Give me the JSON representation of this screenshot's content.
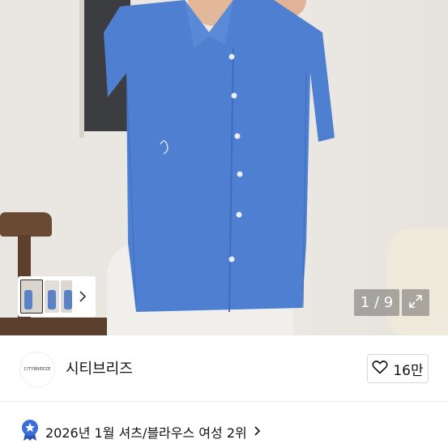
{
  "gallery": {
    "counter": "1 / 9",
    "icons": {
      "expand": "expand-icon",
      "next": "chevron-right-icon"
    }
  },
  "seller": {
    "logo_text": "CITYBREEZE",
    "name": "시티브리즈",
    "like_count": "16만",
    "like_icon": "heart-outline-icon"
  },
  "ranking": {
    "text": "2026년 1월 셔츠/블라우스 여성 2위",
    "badge_icon": "award-badge-icon",
    "badge_color": "#3a6fd8"
  },
  "colors": {
    "shirt": "#4f7fd0",
    "text": "#111111",
    "border": "#d6d6d6"
  }
}
